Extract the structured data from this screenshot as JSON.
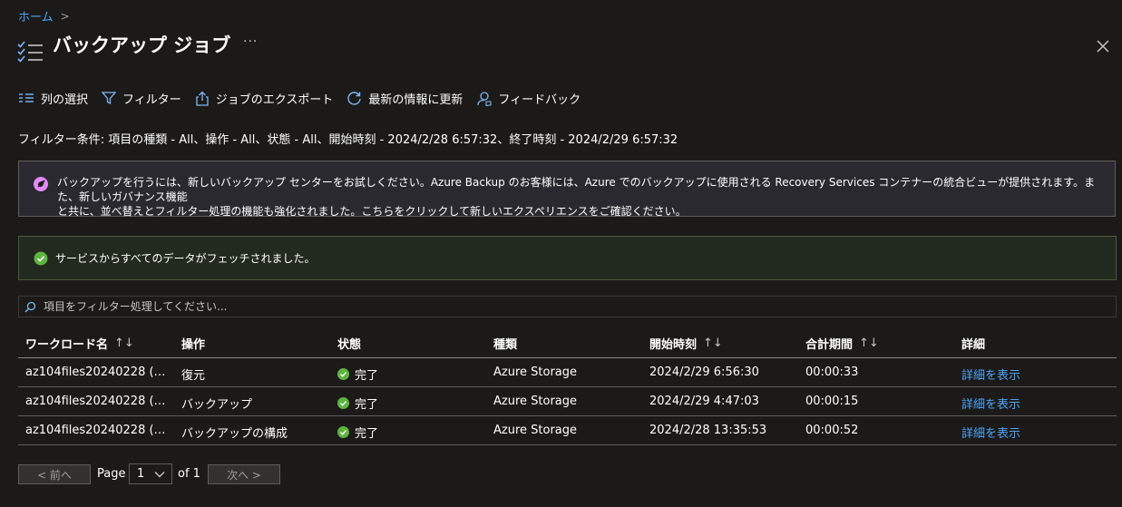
{
  "breadcrumb": {
    "home": "ホーム",
    "separator": ">"
  },
  "header": {
    "title": "バックアップ ジョブ",
    "more": "···"
  },
  "toolbar": {
    "columns": "列の選択",
    "filter": "フィルター",
    "export": "ジョブのエクスポート",
    "refresh": "最新の情報に更新",
    "feedback": "フィードバック"
  },
  "filter_info": "フィルター条件: 項目の種類 - All、操作 - All、状態 - All、開始時刻 - 2024/2/28 6:57:32、終了時刻 - 2024/2/29 6:57:32",
  "info_banner": {
    "line1": "バックアップを行うには、新しいバックアップ センターをお試しください。Azure Backup のお客様には、Azure でのバックアップに使用される Recovery Services コンテナーの統合ビューが提供されます。また、新しいガバナンス機能",
    "line2": "と共に、並べ替えとフィルター処理の機能も強化されました。こちらをクリックして新しいエクスペリエンスをご確認ください。",
    "accent": "#e28af8"
  },
  "success_banner": {
    "text": "サービスからすべてのデータがフェッチされました。",
    "accent": "#5db53f"
  },
  "search": {
    "placeholder": "項目をフィルター処理してください..."
  },
  "table": {
    "headers": {
      "workload": "ワークロード名",
      "operation": "操作",
      "status": "状態",
      "type": "種類",
      "start": "開始時刻",
      "duration": "合計期間",
      "details": "詳細"
    },
    "sort_glyph": "↑↓",
    "rows": [
      {
        "workload": "az104files20240228 (…",
        "operation": "復元",
        "status": "完了",
        "type": "Azure Storage",
        "start": "2024/2/29 6:56:30",
        "duration": "00:00:33",
        "details": "詳細を表示"
      },
      {
        "workload": "az104files20240228 (…",
        "operation": "バックアップ",
        "status": "完了",
        "type": "Azure Storage",
        "start": "2024/2/29 4:47:03",
        "duration": "00:00:15",
        "details": "詳細を表示"
      },
      {
        "workload": "az104files20240228 (…",
        "operation": "バックアップの構成",
        "status": "完了",
        "type": "Azure Storage",
        "start": "2024/2/28 13:35:53",
        "duration": "00:00:52",
        "details": "詳細を表示"
      }
    ]
  },
  "pagination": {
    "prev": "< 前へ",
    "page_label": "Page",
    "page_value": "1",
    "of_label": "of 1",
    "next": "次へ >"
  }
}
